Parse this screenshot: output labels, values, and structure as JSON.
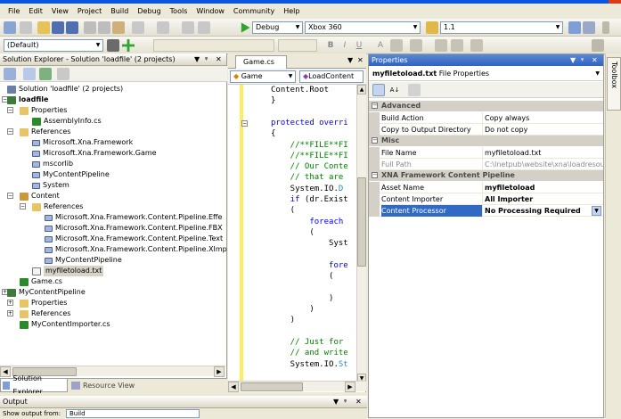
{
  "menu": [
    "File",
    "Edit",
    "View",
    "Project",
    "Build",
    "Debug",
    "Tools",
    "Window",
    "Community",
    "Help"
  ],
  "toolbar": {
    "config_combo": "Debug",
    "platform_combo": "Xbox 360",
    "version_combo": "1.1",
    "style_combo": "(Default)"
  },
  "solution_explorer": {
    "title": "Solution Explorer - Solution 'loadfile' (2 projects)",
    "tree": [
      {
        "label": "Solution 'loadfile' (2 projects)",
        "level": 0,
        "icon": "solution-icon"
      },
      {
        "label": "loadfile",
        "level": 0,
        "icon": "project-icon",
        "bold": true
      },
      {
        "label": "Properties",
        "level": 1,
        "icon": "folder-icon"
      },
      {
        "label": "AssemblyInfo.cs",
        "level": 2,
        "icon": "cs-file-icon"
      },
      {
        "label": "References",
        "level": 1,
        "icon": "folder-icon"
      },
      {
        "label": "Microsoft.Xna.Framework",
        "level": 2,
        "icon": "reference-icon"
      },
      {
        "label": "Microsoft.Xna.Framework.Game",
        "level": 2,
        "icon": "reference-icon"
      },
      {
        "label": "mscorlib",
        "level": 2,
        "icon": "reference-icon"
      },
      {
        "label": "MyContentPipeline",
        "level": 2,
        "icon": "reference-icon"
      },
      {
        "label": "System",
        "level": 2,
        "icon": "reference-icon"
      },
      {
        "label": "Content",
        "level": 1,
        "icon": "content-icon"
      },
      {
        "label": "References",
        "level": 2,
        "icon": "folder-icon"
      },
      {
        "label": "Microsoft.Xna.Framework.Content.Pipeline.Effe",
        "level": 3,
        "icon": "reference-icon"
      },
      {
        "label": "Microsoft.Xna.Framework.Content.Pipeline.FBX",
        "level": 3,
        "icon": "reference-icon"
      },
      {
        "label": "Microsoft.Xna.Framework.Content.Pipeline.Text",
        "level": 3,
        "icon": "reference-icon"
      },
      {
        "label": "Microsoft.Xna.Framework.Content.Pipeline.XImp",
        "level": 3,
        "icon": "reference-icon"
      },
      {
        "label": "MyContentPipeline",
        "level": 3,
        "icon": "reference-icon"
      },
      {
        "label": "myfiletoload.txt",
        "level": 2,
        "icon": "text-file-icon",
        "selected": true
      },
      {
        "label": "Game.cs",
        "level": 1,
        "icon": "cs-file-icon"
      },
      {
        "label": "MyContentPipeline",
        "level": 0,
        "icon": "project-icon"
      },
      {
        "label": "Properties",
        "level": 1,
        "icon": "folder-icon"
      },
      {
        "label": "References",
        "level": 1,
        "icon": "folder-icon"
      },
      {
        "label": "MyContentImporter.cs",
        "level": 1,
        "icon": "cs-file-icon"
      }
    ],
    "tabs": [
      "Solution Explorer",
      "Resource View"
    ]
  },
  "editor": {
    "tab": "Game.cs",
    "nav_left": "Game",
    "nav_right": "LoadContent",
    "lines": [
      {
        "segments": [
          {
            "t": "Content.Root",
            "c": ""
          }
        ]
      },
      {
        "segments": [
          {
            "t": "}",
            "c": ""
          }
        ]
      },
      {
        "segments": [
          {
            "t": "",
            "c": ""
          }
        ]
      },
      {
        "segments": [
          {
            "t": "protected overri",
            "c": "kw"
          }
        ]
      },
      {
        "segments": [
          {
            "t": "{",
            "c": ""
          }
        ]
      },
      {
        "segments": [
          {
            "t": "    //**FILE**FI",
            "c": "cm"
          }
        ]
      },
      {
        "segments": [
          {
            "t": "    //**FILE**FI",
            "c": "cm"
          }
        ]
      },
      {
        "segments": [
          {
            "t": "    // Our Conte",
            "c": "cm"
          }
        ]
      },
      {
        "segments": [
          {
            "t": "    // that are ",
            "c": "cm"
          }
        ]
      },
      {
        "segments": [
          {
            "t": "    System.IO.",
            "c": ""
          },
          {
            "t": "D",
            "c": "tn"
          }
        ]
      },
      {
        "segments": [
          {
            "t": "    if",
            "c": "kw"
          },
          {
            "t": " (dr.Exist",
            "c": ""
          }
        ]
      },
      {
        "segments": [
          {
            "t": "    (",
            "c": ""
          }
        ]
      },
      {
        "segments": [
          {
            "t": "        foreach",
            "c": "kw"
          }
        ]
      },
      {
        "segments": [
          {
            "t": "        (",
            "c": ""
          }
        ]
      },
      {
        "segments": [
          {
            "t": "            Syst",
            "c": ""
          }
        ]
      },
      {
        "segments": [
          {
            "t": "",
            "c": ""
          }
        ]
      },
      {
        "segments": [
          {
            "t": "            fore",
            "c": "kw"
          }
        ]
      },
      {
        "segments": [
          {
            "t": "            (",
            "c": ""
          }
        ]
      },
      {
        "segments": [
          {
            "t": "",
            "c": ""
          }
        ]
      },
      {
        "segments": [
          {
            "t": "            )",
            "c": ""
          }
        ]
      },
      {
        "segments": [
          {
            "t": "        )",
            "c": ""
          }
        ]
      },
      {
        "segments": [
          {
            "t": "    )",
            "c": ""
          }
        ]
      },
      {
        "segments": [
          {
            "t": "",
            "c": ""
          }
        ]
      },
      {
        "segments": [
          {
            "t": "    // Just for",
            "c": "cm"
          }
        ]
      },
      {
        "segments": [
          {
            "t": "    // and write",
            "c": "cm"
          }
        ]
      },
      {
        "segments": [
          {
            "t": "    System.IO.",
            "c": ""
          },
          {
            "t": "St",
            "c": "tn"
          }
        ]
      }
    ]
  },
  "properties": {
    "title": "Properties",
    "object_name": "myfiletoload.txt",
    "object_type": "File Properties",
    "categories": [
      {
        "name": "Advanced",
        "rows": [
          {
            "name": "Build Action",
            "value": "Copy always"
          },
          {
            "name": "Copy to Output Directory",
            "value": "Do not copy"
          }
        ]
      },
      {
        "name": "Misc",
        "rows": [
          {
            "name": "File Name",
            "value": "myfiletoload.txt"
          },
          {
            "name": "Full Path",
            "value": "C:\\Inetpub\\website\\xna\\loadresourc",
            "gray": true
          }
        ]
      },
      {
        "name": "XNA Framework Content Pipeline",
        "rows": [
          {
            "name": "Asset Name",
            "value": "myfiletoload",
            "bold": true
          },
          {
            "name": "Content Importer",
            "value": "All Importer",
            "bold": true
          },
          {
            "name": "Content Processor",
            "value": "No Processing Required",
            "selected": true
          }
        ]
      }
    ]
  },
  "toolbox_label": "Toolbox",
  "output": {
    "title": "Output",
    "show_from_label": "Show output from:",
    "show_from_value": "Build"
  }
}
